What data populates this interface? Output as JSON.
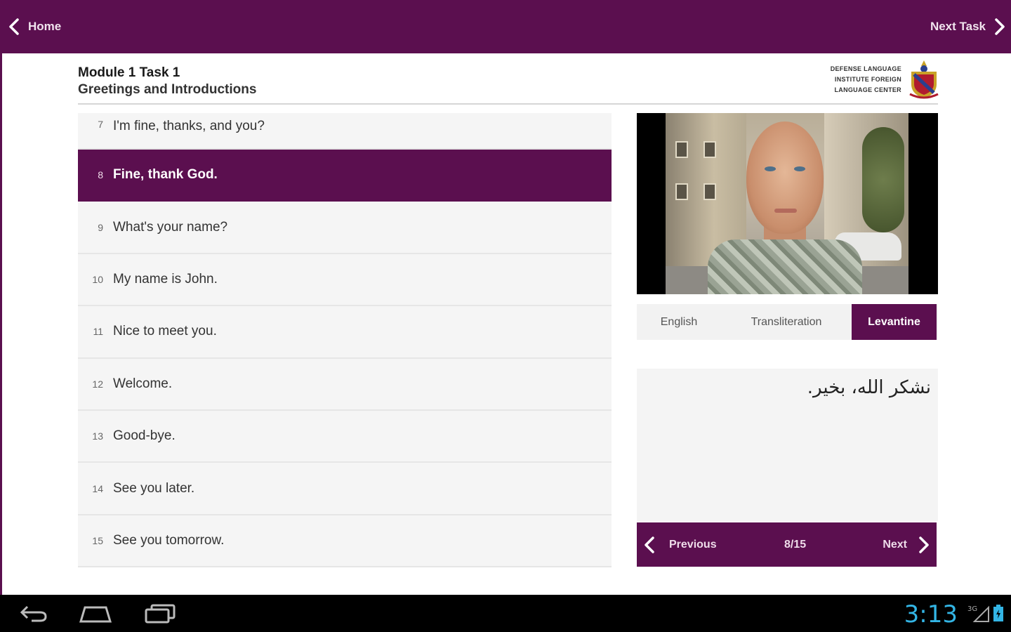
{
  "topbar": {
    "home_label": "Home",
    "next_task_label": "Next Task"
  },
  "header": {
    "module_title": "Module 1 Task 1",
    "module_subtitle": "Greetings and Introductions",
    "logo_lines": [
      "DEFENSE LANGUAGE",
      "INSTITUTE FOREIGN",
      "LANGUAGE CENTER"
    ]
  },
  "phrases": [
    {
      "num": "7",
      "text": "I'm fine, thanks, and you?"
    },
    {
      "num": "8",
      "text": "Fine, thank God."
    },
    {
      "num": "9",
      "text": "What's your name?"
    },
    {
      "num": "10",
      "text": "My name is John."
    },
    {
      "num": "11",
      "text": "Nice to meet you."
    },
    {
      "num": "12",
      "text": "Welcome."
    },
    {
      "num": "13",
      "text": "Good-bye."
    },
    {
      "num": "14",
      "text": "See you later."
    },
    {
      "num": "15",
      "text": "See you tomorrow."
    }
  ],
  "selected_phrase": "8",
  "lang_tabs": [
    "English",
    "Transliteration",
    "Levantine"
  ],
  "active_lang_tab": "Levantine",
  "arabic_text": "نشكر الله، بخير.",
  "pager": {
    "previous_label": "Previous",
    "count": "8/15",
    "next_label": "Next"
  },
  "status": {
    "clock": "3:13",
    "network": "3G"
  },
  "colors": {
    "accent": "#5b0f4f",
    "clock": "#33b5e5"
  }
}
